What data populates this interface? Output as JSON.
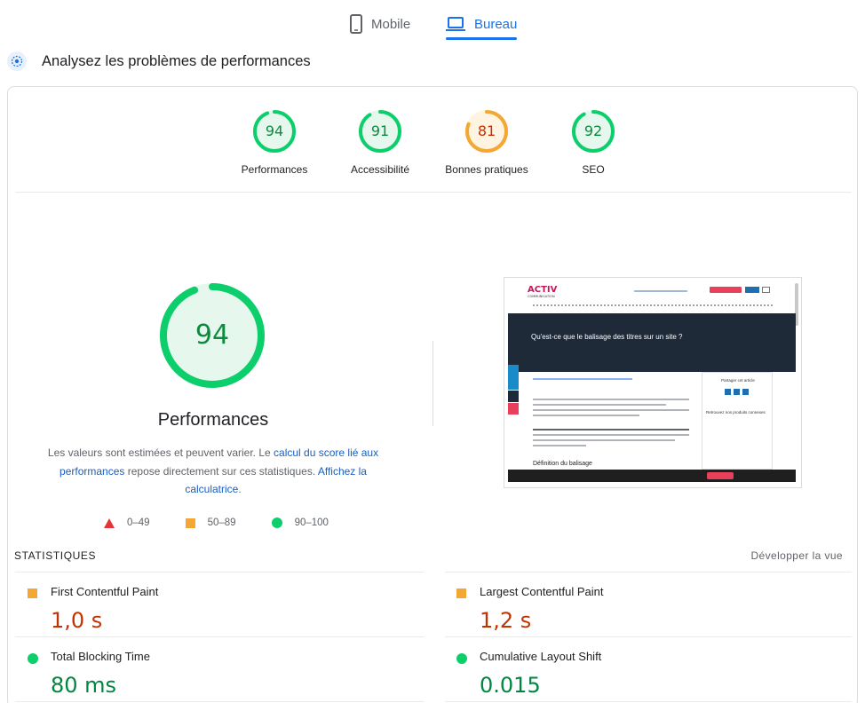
{
  "device_tabs": [
    {
      "label": "Mobile",
      "icon": "phone-icon",
      "active": false
    },
    {
      "label": "Bureau",
      "icon": "laptop-icon",
      "active": true
    }
  ],
  "heading": {
    "icon": "lighthouse-icon",
    "title": "Analysez les problèmes de performances"
  },
  "categories": [
    {
      "label": "Performances",
      "score": "94",
      "level": 0.94,
      "rating": "pass",
      "color": "#0cce6b",
      "text_color": "#0c8a3d"
    },
    {
      "label": "Accessibilité",
      "score": "91",
      "level": 0.91,
      "rating": "pass",
      "color": "#0cce6b",
      "text_color": "#0c8a3d"
    },
    {
      "label": "Bonnes pratiques",
      "score": "81",
      "level": 0.81,
      "rating": "average",
      "color": "#f4a833",
      "text_color": "#c33300"
    },
    {
      "label": "SEO",
      "score": "92",
      "level": 0.92,
      "rating": "pass",
      "color": "#0cce6b",
      "text_color": "#0c8a3d"
    }
  ],
  "main_gauge": {
    "score": "94",
    "level": 0.94,
    "label": "Performances",
    "color": "#0cce6b"
  },
  "description": {
    "part1": "Les valeurs sont estimées et peuvent varier. Le ",
    "link1": "calcul du score lié aux performances",
    "part2": " repose directement sur ces statistiques. ",
    "link2": "Affichez la calculatrice",
    "part3": "."
  },
  "legend": [
    {
      "shape": "triangle",
      "range": "0–49",
      "color": "#e5343a"
    },
    {
      "shape": "square",
      "range": "50–89",
      "color": "#f4a833"
    },
    {
      "shape": "circle",
      "range": "90–100",
      "color": "#0cce6b"
    }
  ],
  "screenshot": {
    "logo": "ACTIV",
    "logo_sub": "COMMUNICATION",
    "hero_title": "Qu'est-ce que le balisage des titres sur un site ?",
    "sidebar_title": "Partager cet article",
    "sidebar_sub": "Retrouvez nos produits connexes",
    "section_title": "Définition du balisage"
  },
  "stats": {
    "section_label": "STATISTIQUES",
    "expand_label": "Développer la vue",
    "metrics": [
      {
        "name": "First Contentful Paint",
        "value": "1,0 s",
        "rating": "average"
      },
      {
        "name": "Largest Contentful Paint",
        "value": "1,2 s",
        "rating": "average"
      },
      {
        "name": "Total Blocking Time",
        "value": "80 ms",
        "rating": "pass"
      },
      {
        "name": "Cumulative Layout Shift",
        "value": "0.015",
        "rating": "pass"
      }
    ]
  }
}
